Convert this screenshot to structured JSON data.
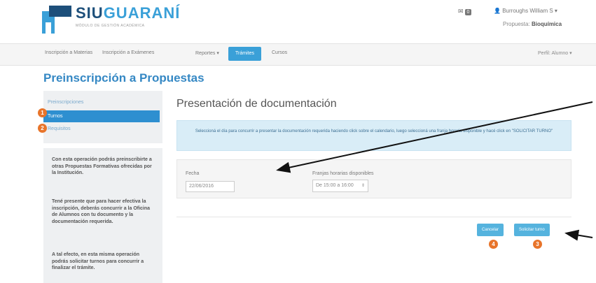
{
  "header": {
    "logo_main": "SIU",
    "logo_accent": "GUARANÍ",
    "logo_sub": "MÓDULO DE GESTIÓN ACADÉMICA",
    "mail_badge": "0",
    "user": "Burroughs William S",
    "proposal_label": "Propuesta:",
    "proposal_value": "Bioquímica"
  },
  "nav": {
    "items": [
      "Inscripción a Materias",
      "Inscripción a Exámenes",
      "Reportes ▾",
      "Trámites",
      "Cursos"
    ],
    "active": "Trámites",
    "profile": "Perfil: Alumno ▾"
  },
  "page_title": "Preinscripción a Propuestas",
  "sidebar": {
    "items": [
      "Preinscripciones",
      "Turnos",
      "Requisitos"
    ],
    "active_index": 1,
    "info_paragraphs": [
      "Con esta operación podrás preinscribirte a otras Propuestas Formativas ofrecidas por la Institución.",
      "Tené presente que para hacer efectiva la inscripción, deberás concurrir a la Oficina de Alumnos con tu documento y la documentación requerida.",
      "A tal efecto, en esta misma operación podrás solicitar turnos para concurrir a finalizar el trámite."
    ]
  },
  "main": {
    "title": "Presentación de documentación",
    "alert_text": "Seleccioná el día para concurrir a presentar la documentación requerida haciendo click sobre el calendario, luego seleccioná una franja horaria disponible y hacé click en \"SOLICITAR TURNO\"",
    "fecha_label": "Fecha",
    "fecha_value": "22/06/2016",
    "franjas_label": "Franjas horarias disponibles",
    "franja_value": "De 15:00 a 16:00",
    "cancel_label": "Cancelar",
    "submit_label": "Solicitar turno"
  },
  "markers": [
    "1",
    "2",
    "4",
    "3"
  ],
  "colors": {
    "brand_dark": "#1d4f7a",
    "brand_light": "#3aa0d8",
    "marker": "#e8742a",
    "button": "#55b3de"
  }
}
